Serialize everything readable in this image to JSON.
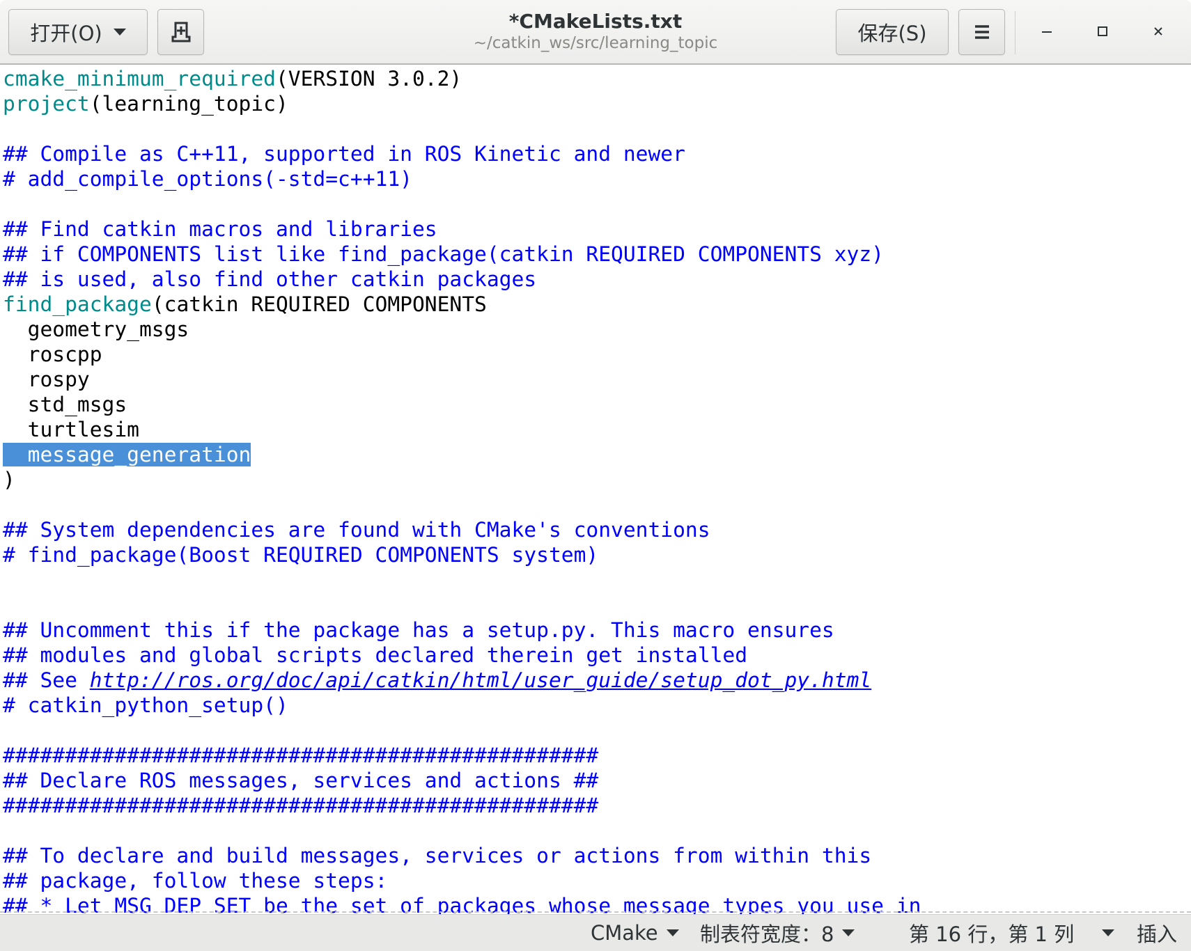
{
  "header": {
    "open_label": "打开(O)",
    "title": "*CMakeLists.txt",
    "subtitle": "~/catkin_ws/src/learning_topic",
    "save_label": "保存(S)"
  },
  "editor": {
    "lines": [
      [
        {
          "t": "cmake_minimum_required",
          "c": "fn"
        },
        {
          "t": "(VERSION 3.0.2)"
        }
      ],
      [
        {
          "t": "project",
          "c": "fn"
        },
        {
          "t": "(learning_topic)"
        }
      ],
      [],
      [
        {
          "t": "## Compile as C++11, supported in ROS Kinetic and newer",
          "c": "cm"
        }
      ],
      [
        {
          "t": "# add_compile_options(-std=c++11)",
          "c": "cm"
        }
      ],
      [],
      [
        {
          "t": "## Find catkin macros and libraries",
          "c": "cm"
        }
      ],
      [
        {
          "t": "## if COMPONENTS list like find_package(catkin REQUIRED COMPONENTS xyz)",
          "c": "cm"
        }
      ],
      [
        {
          "t": "## is used, also find other catkin packages",
          "c": "cm"
        }
      ],
      [
        {
          "t": "find_package",
          "c": "fn"
        },
        {
          "t": "(catkin REQUIRED COMPONENTS"
        }
      ],
      [
        {
          "t": "  geometry_msgs"
        }
      ],
      [
        {
          "t": "  roscpp"
        }
      ],
      [
        {
          "t": "  rospy"
        }
      ],
      [
        {
          "t": "  std_msgs"
        }
      ],
      [
        {
          "t": "  turtlesim"
        }
      ],
      [
        {
          "t": "  message_generation",
          "c": "sel"
        }
      ],
      [
        {
          "t": ")"
        }
      ],
      [],
      [
        {
          "t": "## System dependencies are found with CMake's conventions",
          "c": "cm"
        }
      ],
      [
        {
          "t": "# find_package(Boost REQUIRED COMPONENTS system)",
          "c": "cm"
        }
      ],
      [],
      [],
      [
        {
          "t": "## Uncomment this if the package has a setup.py. This macro ensures",
          "c": "cm"
        }
      ],
      [
        {
          "t": "## modules and global scripts declared therein get installed",
          "c": "cm"
        }
      ],
      [
        {
          "t": "## See ",
          "c": "cm"
        },
        {
          "t": "http://ros.org/doc/api/catkin/html/user_guide/setup_dot_py.html",
          "c": "url"
        }
      ],
      [
        {
          "t": "# catkin_python_setup()",
          "c": "cm"
        }
      ],
      [],
      [
        {
          "t": "################################################",
          "c": "cm"
        }
      ],
      [
        {
          "t": "## Declare ROS messages, services and actions ##",
          "c": "cm"
        }
      ],
      [
        {
          "t": "################################################",
          "c": "cm"
        }
      ],
      [],
      [
        {
          "t": "## To declare and build messages, services or actions from within this",
          "c": "cm"
        }
      ],
      [
        {
          "t": "## package, follow these steps:",
          "c": "cm"
        }
      ],
      [
        {
          "t": "## * Let MSG_DEP_SET be the set of packages whose message types you use in",
          "c": "cm"
        }
      ]
    ]
  },
  "status": {
    "language": "CMake",
    "tab_width": "制表符宽度：8",
    "position": "第 16 行，第 1 列",
    "mode": "插入"
  },
  "colors": {
    "function": "#008b8b",
    "comment": "#0000ff",
    "selection": "#4a90d9"
  }
}
